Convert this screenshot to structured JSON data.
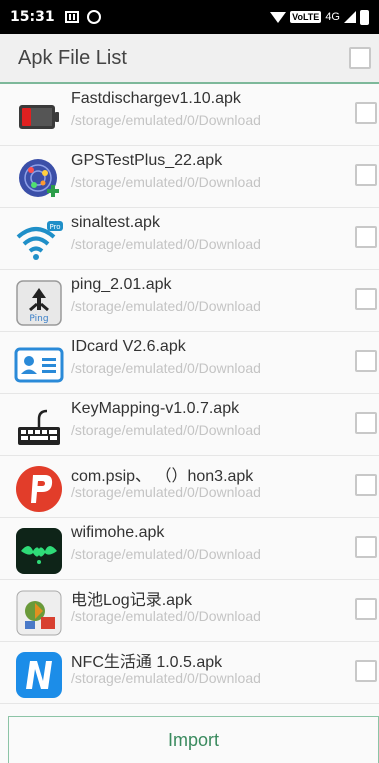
{
  "status_bar": {
    "time": "15:31",
    "network_badge": "VoLTE",
    "network_type": "4G"
  },
  "header": {
    "title": "Apk File List"
  },
  "files": [
    {
      "name": "Fastdischargev1.10.apk",
      "path": "/storage/emulated/0/Download",
      "icon": "battery-icon"
    },
    {
      "name": "GPSTestPlus_22.apk",
      "path": "/storage/emulated/0/Download",
      "icon": "gps-radar-icon"
    },
    {
      "name": "sinaltest.apk",
      "path": "/storage/emulated/0/Download",
      "icon": "wifi-signal-icon"
    },
    {
      "name": "ping_2.01.apk",
      "path": "/storage/emulated/0/Download",
      "icon": "ping-icon"
    },
    {
      "name": "IDcard V2.6.apk",
      "path": "/storage/emulated/0/Download",
      "icon": "id-card-icon"
    },
    {
      "name": "KeyMapping-v1.0.7.apk",
      "path": "/storage/emulated/0/Download",
      "icon": "keyboard-icon"
    },
    {
      "name": "com.psip、 （）hon3.apk",
      "path": "/storage/emulated/0/Download",
      "icon": "psiphon-icon"
    },
    {
      "name": "wifimohe.apk",
      "path": "/storage/emulated/0/Download",
      "icon": "wifimohe-icon"
    },
    {
      "name": "电池Log记录.apk",
      "path": "/storage/emulated/0/Download",
      "icon": "battery-log-icon"
    },
    {
      "name": "NFC生活通 1.0.5.apk",
      "path": "/storage/emulated/0/Download",
      "icon": "nfc-icon"
    }
  ],
  "footer": {
    "import_label": "Import"
  },
  "colors": {
    "accent": "#3a8a5e",
    "divider": "#7db89a",
    "path_text": "#c4c4c4"
  }
}
